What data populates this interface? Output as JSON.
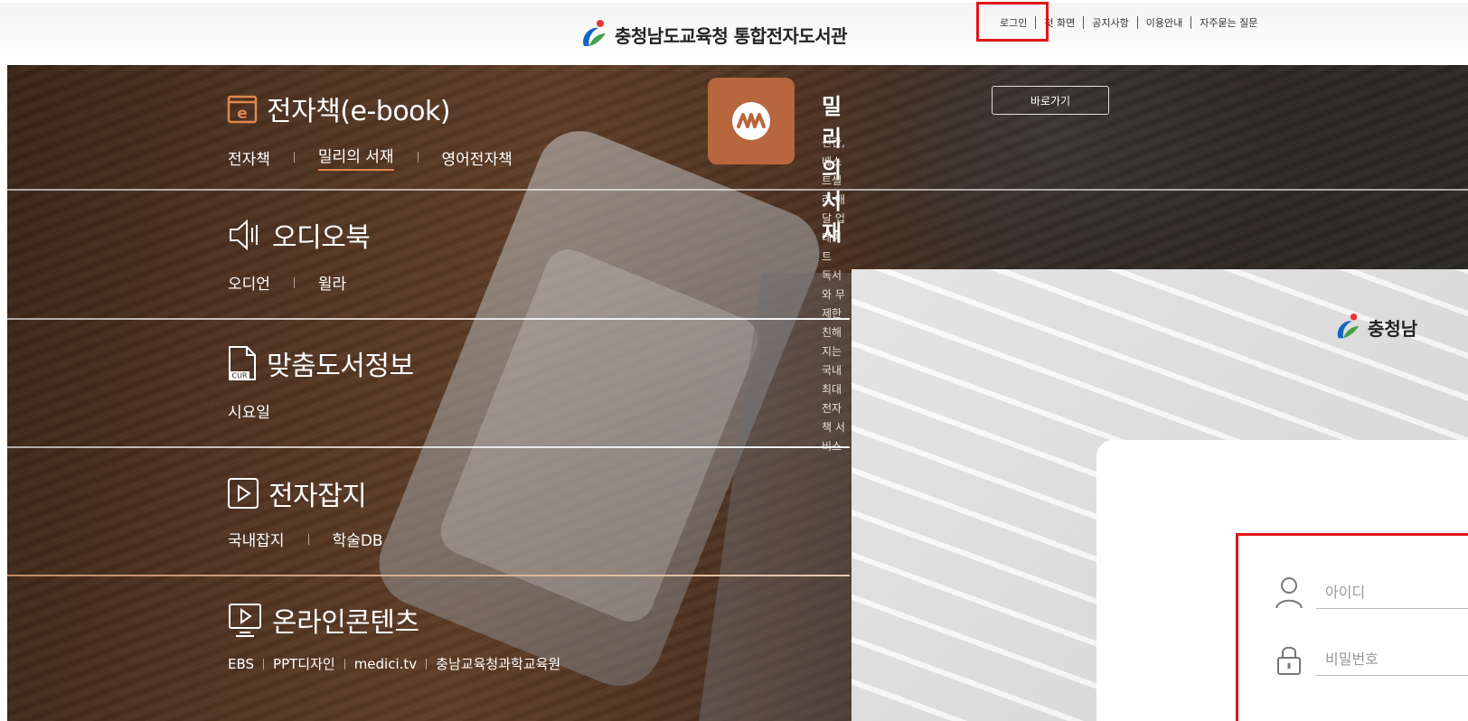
{
  "header": {
    "logo_text": "충청남도교육청 통합전자도서관",
    "links": [
      "로그인",
      "첫 화면",
      "공지사항",
      "이용안내",
      "자주묻는 질문"
    ]
  },
  "ebook": {
    "title": "전자책(e-book)",
    "subs": [
      "전자책",
      "밀리의 서재",
      "영어전자책"
    ],
    "promo": {
      "name": "밀리의 서재",
      "go_label": "바로가기",
      "desc_line1": "신간, 베스트셀러 매달 업데이트",
      "desc_line2": "독서와 무제한 친해지는 국내 최대 전자책 서비스"
    }
  },
  "audiobook": {
    "title": "오디오북",
    "subs": [
      "오디언",
      "윌라"
    ]
  },
  "custom": {
    "title": "맞춤도서정보",
    "icon_label": "CUR",
    "subs": [
      "시요일"
    ]
  },
  "magazine": {
    "title": "전자잡지",
    "subs": [
      "국내잡지",
      "학술DB"
    ]
  },
  "online": {
    "title": "온라인콘텐츠",
    "subs": [
      "EBS",
      "PPT디자인",
      "medici.tv",
      "충남교육청과학교육원"
    ]
  },
  "login": {
    "logo_text": "충청남",
    "id_placeholder": "아이디",
    "pw_placeholder": "비밀번호"
  },
  "colors": {
    "accent": "#e0874c",
    "highlight": "#e0161a",
    "millie": "#b8663d"
  }
}
